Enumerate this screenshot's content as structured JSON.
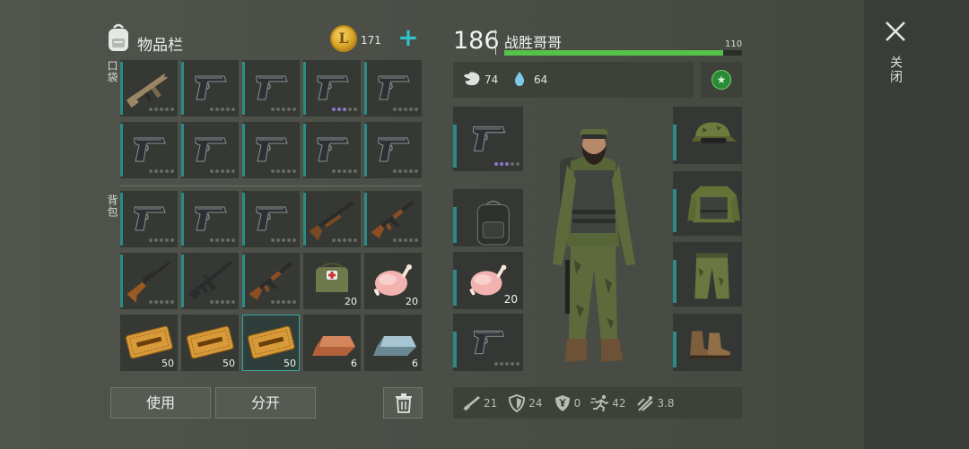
{
  "inventory": {
    "title": "物品栏",
    "coins": "171",
    "coin_symbol": "L",
    "add_label": "+",
    "pocket_label": "口袋",
    "backpack_label": "背包",
    "pocket_slots": [
      {
        "item": "assault-rifle",
        "qty": "",
        "quality": 0
      },
      {
        "item": "pistol",
        "qty": "",
        "quality": 0
      },
      {
        "item": "pistol",
        "qty": "",
        "quality": 0
      },
      {
        "item": "pistol",
        "qty": "",
        "quality": 3
      },
      {
        "item": "pistol",
        "qty": "",
        "quality": 0
      },
      {
        "item": "pistol",
        "qty": "",
        "quality": 0
      },
      {
        "item": "pistol",
        "qty": "",
        "quality": 0
      },
      {
        "item": "pistol",
        "qty": "",
        "quality": 0
      },
      {
        "item": "pistol",
        "qty": "",
        "quality": 0
      },
      {
        "item": "pistol",
        "qty": "",
        "quality": 0
      }
    ],
    "backpack_slots": [
      {
        "item": "pistol",
        "qty": "",
        "quality": 0
      },
      {
        "item": "pistol",
        "qty": "",
        "quality": 0
      },
      {
        "item": "pistol",
        "qty": "",
        "quality": 0
      },
      {
        "item": "shotgun",
        "qty": "",
        "quality": 0
      },
      {
        "item": "ak-rifle",
        "qty": "",
        "quality": 0
      },
      {
        "item": "hunting-rifle",
        "qty": "",
        "quality": 0
      },
      {
        "item": "m16-rifle",
        "qty": "",
        "quality": 0
      },
      {
        "item": "ak-rifle",
        "qty": "",
        "quality": 0
      },
      {
        "item": "medkit-bag",
        "qty": "20",
        "quality": 0
      },
      {
        "item": "raw-chicken",
        "qty": "20",
        "quality": 0
      },
      {
        "item": "coupon",
        "qty": "50",
        "quality": 0
      },
      {
        "item": "coupon",
        "qty": "50",
        "quality": 0
      },
      {
        "item": "coupon",
        "qty": "50",
        "quality": 0,
        "selected": true
      },
      {
        "item": "copper-ingot",
        "qty": "6",
        "quality": 0
      },
      {
        "item": "iron-ingot",
        "qty": "6",
        "quality": 0
      }
    ],
    "use_label": "使用",
    "split_label": "分开"
  },
  "character": {
    "level": "186",
    "name": "战胜哥哥",
    "hp_max": "110",
    "hp_fraction": 0.92,
    "food": "74",
    "water": "64",
    "left_slots": [
      {
        "item": "pistol",
        "qty": "",
        "quality": 3
      },
      {
        "item": "backpack",
        "qty": ""
      },
      {
        "item": "raw-chicken",
        "qty": "20"
      },
      {
        "item": "pistol",
        "qty": "",
        "quality": 0
      }
    ],
    "right_slots": [
      "camo-cap",
      "camo-vest",
      "camo-pants",
      "boots"
    ],
    "stats": {
      "attack": "21",
      "defense": "24",
      "radiation": "0",
      "speed": "42",
      "stealth": "3.8"
    }
  },
  "close_label": "关闭",
  "colors": {
    "accent": "#2fc0c9",
    "teal_bar": "#2a8b88",
    "hp_green": "#55c24a",
    "slot_bg": "#353833"
  }
}
